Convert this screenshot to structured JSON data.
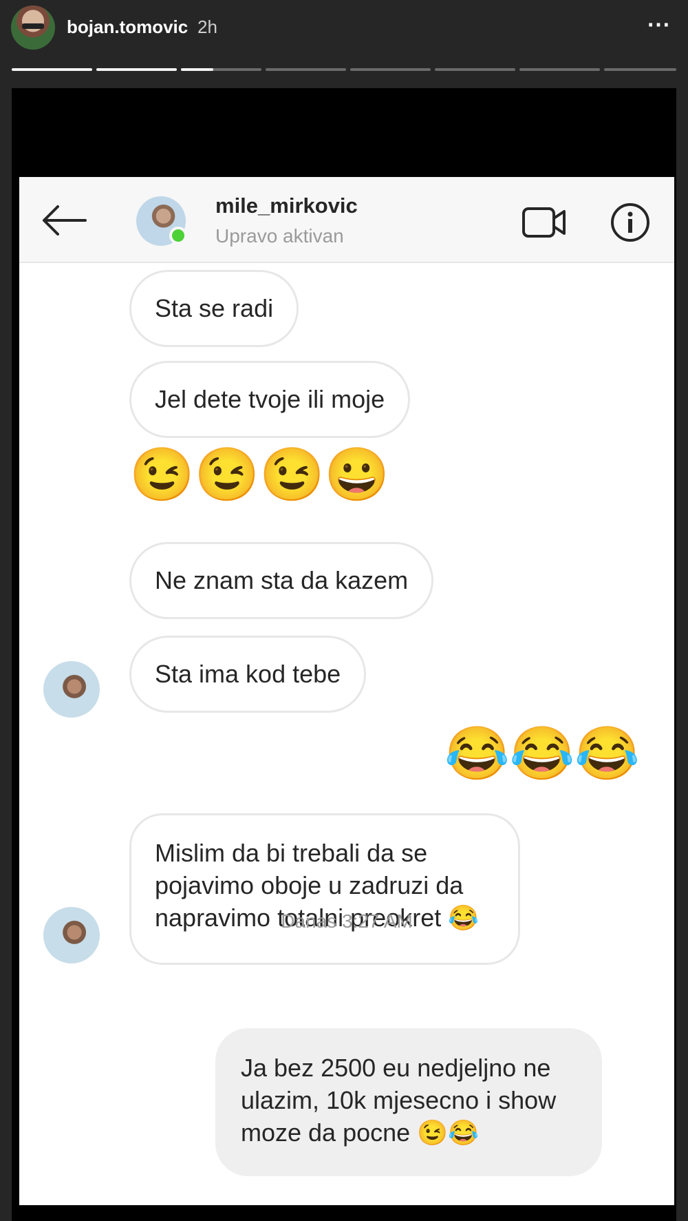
{
  "story": {
    "username": "bojan.tomovic",
    "time": "2h",
    "more_icon": "⋯",
    "progress_segments": 8,
    "progress_seen": 2
  },
  "chat": {
    "peer_name": "mile_mirkovic",
    "peer_status": "Upravo aktivan",
    "messages": [
      {
        "text": "Sta se radi"
      },
      {
        "text": "Jel dete tvoje ili moje"
      },
      {
        "emoji": "😉😉😉😀"
      },
      {
        "text": "Ne znam sta da kazem"
      },
      {
        "text": "Sta ima kod tebe"
      },
      {
        "emoji": "😂😂😂"
      },
      {
        "text": "Mislim da bi trebali da se pojavimo oboje u zadruzi da napravimo totalni preokret 😂"
      },
      {
        "text": "Ja bez 2500 eu nedjeljno ne ulazim, 10k mjesecno i show moze da pocne 😉😂"
      }
    ],
    "timestamp": "Danas 3:27 AM"
  },
  "colors": {
    "online": "#4cd137",
    "bubble_border": "#e7e7e7",
    "my_bubble": "#efefef"
  }
}
